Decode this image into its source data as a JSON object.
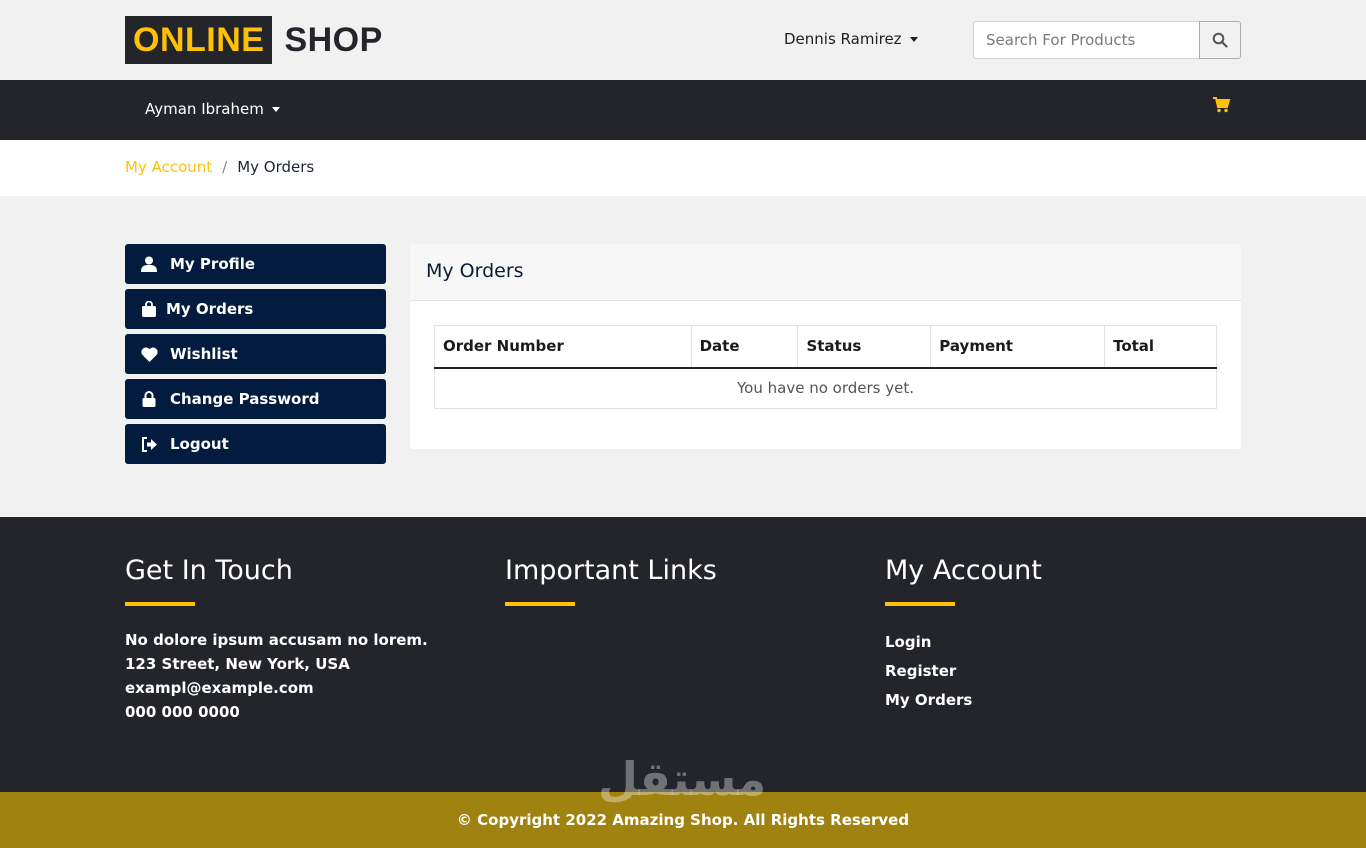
{
  "brand": {
    "part1": "ONLINE",
    "part2": "SHOP",
    "accent_color": "#ffc107",
    "dark_color": "#23252b"
  },
  "top": {
    "user_name": "Dennis Ramirez",
    "search_placeholder": "Search For Products",
    "search_icon": "search-icon"
  },
  "navbar": {
    "user_name": "Ayman Ibrahem",
    "cart_icon": "cart-icon"
  },
  "breadcrumb": {
    "link": "My Account",
    "separator": "/",
    "current": "My Orders"
  },
  "sidebar": {
    "items": [
      {
        "label": "My Profile",
        "icon": "user-icon"
      },
      {
        "label": "My Orders",
        "icon": "bag-icon"
      },
      {
        "label": "Wishlist",
        "icon": "heart-icon"
      },
      {
        "label": "Change Password",
        "icon": "lock-icon"
      },
      {
        "label": "Logout",
        "icon": "logout-icon"
      }
    ],
    "bg_color": "#021b3e"
  },
  "orders": {
    "title": "My Orders",
    "columns": [
      "Order Number",
      "Date",
      "Status",
      "Payment",
      "Total"
    ],
    "empty_message": "You have no orders yet."
  },
  "footer": {
    "contact": {
      "title": "Get In Touch",
      "lines": [
        "No dolore ipsum accusam no lorem.",
        "123 Street, New York, USA",
        "exampl@example.com",
        "000 000 0000"
      ]
    },
    "links": {
      "title": "Important Links"
    },
    "account": {
      "title": "My Account",
      "links": [
        "Login",
        "Register",
        "My Orders"
      ]
    },
    "copyright": "© Copyright 2022 Amazing Shop. All Rights Reserved"
  },
  "watermark": "مستقل"
}
